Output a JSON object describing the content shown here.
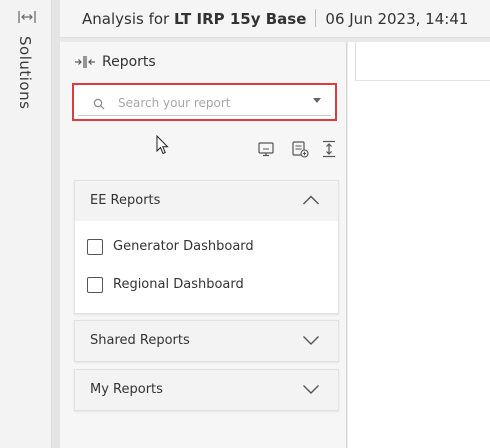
{
  "solutions": {
    "label": "Solutions",
    "expand_icon": "horizontal-expand-icon"
  },
  "header": {
    "prefix": "Analysis for",
    "title": "LT IRP 15y Base",
    "timestamp": "06 Jun 2023, 14:41"
  },
  "panel": {
    "title": "Reports",
    "collapse_icon": "collapse-panel-icon",
    "search": {
      "placeholder": "Search your report"
    },
    "toolbar": [
      "monitor-icon",
      "add-report-icon",
      "upload-icon"
    ]
  },
  "sections": [
    {
      "title": "EE Reports",
      "expanded": true,
      "items": [
        {
          "label": "Generator Dashboard",
          "checked": false
        },
        {
          "label": "Regional Dashboard",
          "checked": false
        }
      ]
    },
    {
      "title": "Shared Reports",
      "expanded": false
    },
    {
      "title": "My Reports",
      "expanded": false
    }
  ],
  "colors": {
    "highlight": "#e0393e",
    "panel_bg": "#f6f6f6"
  }
}
